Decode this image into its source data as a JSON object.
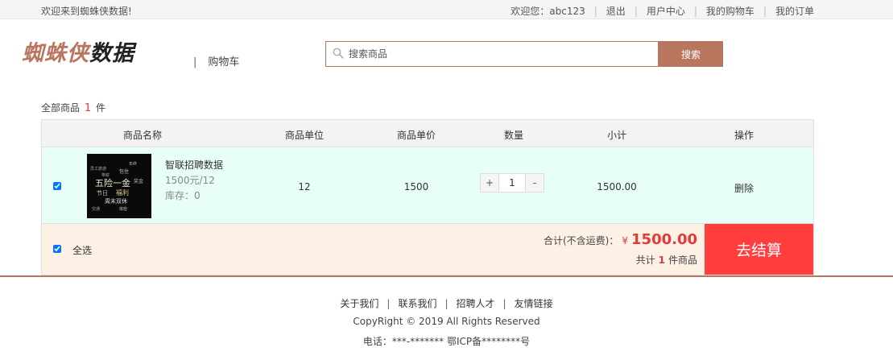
{
  "topbar": {
    "welcome_text": "欢迎来到蜘蛛侠数据!",
    "greeting": "欢迎您：abc123",
    "links": [
      "退出",
      "用户中心",
      "我的购物车",
      "我的订单"
    ]
  },
  "header": {
    "logo_part1": "蜘蛛侠",
    "logo_part2": "数据",
    "crumb_sep": "|",
    "crumb": "购物车"
  },
  "search": {
    "placeholder": "搜索商品",
    "button_label": "搜索"
  },
  "cart": {
    "count_prefix": "全部商品",
    "count": "1",
    "count_suffix": "件",
    "columns": [
      "商品名称",
      "商品单位",
      "商品单价",
      "数量",
      "小计",
      "操作"
    ],
    "items": [
      {
        "name": "智联招聘数据",
        "spec": "1500元/12",
        "stock": "库存：0",
        "unit": "12",
        "price": "1500",
        "qty": "1",
        "plus": "+",
        "minus": "-",
        "subtotal": "1500.00",
        "action": "删除",
        "thumb_words": [
          "五险一金",
          "福利",
          "节日",
          "周末双休",
          "员工旅游",
          "年终",
          "包住",
          "奖金",
          "交通",
          "体检",
          "带薪"
        ]
      }
    ],
    "select_all": "全选",
    "total_label": "合计(不含运费)：",
    "currency": "¥",
    "total": "1500.00",
    "items_prefix": "共计",
    "items_count": "1",
    "items_suffix": "件商品",
    "checkout_label": "去结算"
  },
  "footer": {
    "links": [
      "关于我们",
      "联系我们",
      "招聘人才",
      "友情链接"
    ],
    "copyright": "CopyRight © 2019 All Rights Reserved",
    "phone": "电话：***-******* 鄂ICP备********号"
  },
  "colors": {
    "brand": "#b8765e",
    "price_red": "#e4393c",
    "checkout_red": "#ff3d3d",
    "row_bg": "#e8fff7",
    "foot_bg": "#fdf1e6"
  }
}
